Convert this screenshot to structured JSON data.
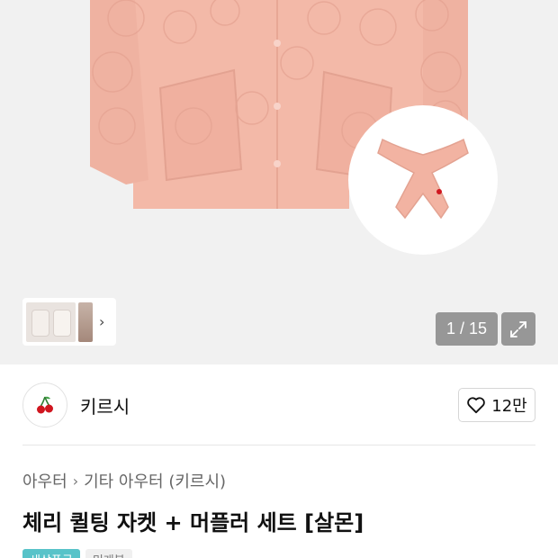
{
  "gallery": {
    "counter": "1 / 15",
    "thumbnail_arrow": "›",
    "expand_icon": "expand-icon"
  },
  "shop": {
    "name": "키르시",
    "avatar_icon": "cherry-icon",
    "like_count": "12만",
    "like_icon": "heart-icon"
  },
  "breadcrumb": {
    "items": [
      "아우터",
      "기타 아우터 (키르시)"
    ],
    "separator": "›"
  },
  "product": {
    "title": "체리 퀼팅 자켓 + 머플러 세트 [살몬]"
  },
  "tags": [
    "새상품급",
    "미개봉"
  ],
  "colors": {
    "jacket": "#f3b9a8",
    "tag_accent": "#58c3c9",
    "cherry": "#d0161f"
  }
}
